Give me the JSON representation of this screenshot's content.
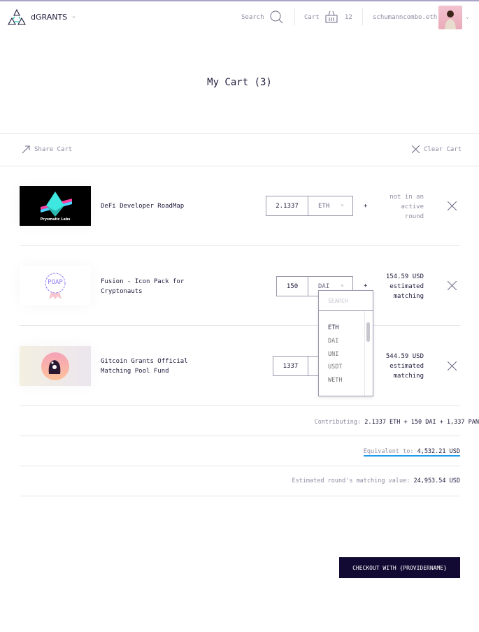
{
  "header": {
    "logo_text": "dGRANTS",
    "search_label": "Search",
    "cart_label": "Cart",
    "cart_count": "12",
    "username": "schumanncombo.eth"
  },
  "page_title": "My Cart (3)",
  "toolbar": {
    "share_label": "Share Cart",
    "clear_label": "Clear Cart"
  },
  "items": [
    {
      "name": "DeFi Developer RoadMap",
      "thumb_text": "Prysmatic Labs",
      "amount": "2.1337",
      "currency": "ETH",
      "status": [
        "not in an",
        "active",
        "round"
      ]
    },
    {
      "name": "Fusion - Icon Pack for Cryptonauts",
      "thumb_text": "POAP",
      "amount": "150",
      "currency": "DAI",
      "status": [
        "154.59 USD",
        "estimated",
        "matching"
      ]
    },
    {
      "name": "Gitcoin Grants Official Matching Pool Fund",
      "amount": "1337",
      "currency": "",
      "status": [
        "544.59 USD",
        "estimated",
        "matching"
      ]
    }
  ],
  "plus": "+",
  "dropdown": {
    "search_placeholder": "SEARCH",
    "options": [
      "ETH",
      "DAI",
      "UNI",
      "USDT",
      "WETH"
    ],
    "selected": "ETH"
  },
  "summary": {
    "contributing_label": "Contributing:",
    "contributing_value": "2.1337 ETH + 150 DAI + 1,337 PAN",
    "equivalent_label": "Equivalent to:",
    "equivalent_value": "4,532.21 USD",
    "matching_label": "Estimated round's matching value:",
    "matching_value": "24,953.54 USD"
  },
  "checkout_label": "CHECKOUT WITH {PROVIDERNAME}",
  "colors": {
    "accent": "#25c5b3",
    "dark": "#120a33",
    "underline": "#1e9bea"
  }
}
